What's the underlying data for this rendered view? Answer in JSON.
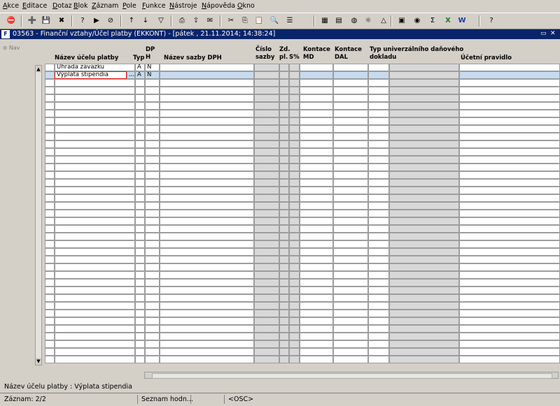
{
  "menu": [
    "Akce",
    "Editace",
    "Dotaz",
    "Blok",
    "Záznam",
    "Pole",
    "Funkce",
    "Nástroje",
    "Nápověda",
    "Okno"
  ],
  "toolbar_icons": [
    "exit-icon",
    "insert-record-icon",
    "save-icon",
    "delete-icon",
    "query-enter-icon",
    "query-execute-icon",
    "query-cancel-icon",
    "sort-ascending-icon",
    "sort-descending-icon",
    "filter-icon",
    "print-icon",
    "export-icon",
    "mail-icon",
    "cut-icon",
    "copy-icon",
    "paste-icon",
    "find-icon",
    "list-icon",
    "calculator-icon",
    "document-icon",
    "globe-icon",
    "settings-icon",
    "warning-icon",
    "report-icon",
    "disk-icon",
    "sum-icon",
    "excel-icon",
    "word-icon",
    "help-icon"
  ],
  "window": {
    "title": "03563 - Finanční vztahy/Účel platby (EKKONT) - [pátek , 21.11.2014; 14:38:24]",
    "icon_text": "F",
    "minimize": "▭",
    "close": "✕"
  },
  "nav_label": "Nav",
  "columns": {
    "name": "Název účelu platby",
    "typ": "Typ",
    "dph": "DP\nH",
    "vat_name": "Název sazby DPH",
    "rate_no": "Číslo\nsazby",
    "zd": "Zd.\npl.",
    "pct": "\nS%",
    "md": "Kontace\nMD",
    "dal": "Kontace\nDAL",
    "doc_type": "Typ univerzálního daňového\ndokladu",
    "rule": "Účetní pravidlo"
  },
  "rows": [
    {
      "name": "Úhrada závazku",
      "typ": "A",
      "dph": "N"
    },
    {
      "name": "Výplata stipendia",
      "typ": "A",
      "dph": "N"
    }
  ],
  "lov_button": "...",
  "status": {
    "message": "Název účelu platby : Výplata stipendia",
    "record": "Záznam: 2/2",
    "list": "Seznam hodn...",
    "osc": "<OSC>"
  }
}
